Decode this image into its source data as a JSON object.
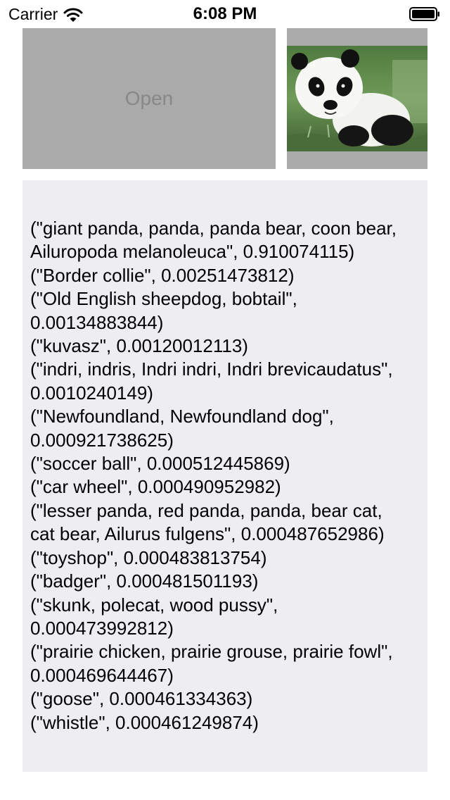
{
  "status_bar": {
    "carrier": "Carrier",
    "time": "6:08 PM"
  },
  "open_button": {
    "label": "Open"
  },
  "colors": {
    "button_bg": "#aaaaaa",
    "button_text": "#888888",
    "panel_bg": "#ededf2"
  },
  "results": [
    "(\"giant panda, panda, panda bear, coon bear, Ailuropoda melanoleuca\", 0.910074115)",
    "(\"Border collie\", 0.00251473812)",
    "(\"Old English sheepdog, bobtail\", 0.00134883844)",
    "(\"kuvasz\", 0.00120012113)",
    "(\"indri, indris, Indri indri, Indri brevicaudatus\", 0.0010240149)",
    "(\"Newfoundland, Newfoundland dog\", 0.000921738625)",
    "(\"soccer ball\", 0.000512445869)",
    "(\"car wheel\", 0.000490952982)",
    "(\"lesser panda, red panda, panda, bear cat, cat bear, Ailurus fulgens\", 0.000487652986)",
    "(\"toyshop\", 0.000483813754)",
    "(\"badger\", 0.000481501193)",
    "(\"skunk, polecat, wood pussy\", 0.000473992812)",
    "(\"prairie chicken, prairie grouse, prairie fowl\", 0.000469644467)",
    "(\"goose\", 0.000461334363)",
    "(\"whistle\", 0.000461249874)"
  ]
}
